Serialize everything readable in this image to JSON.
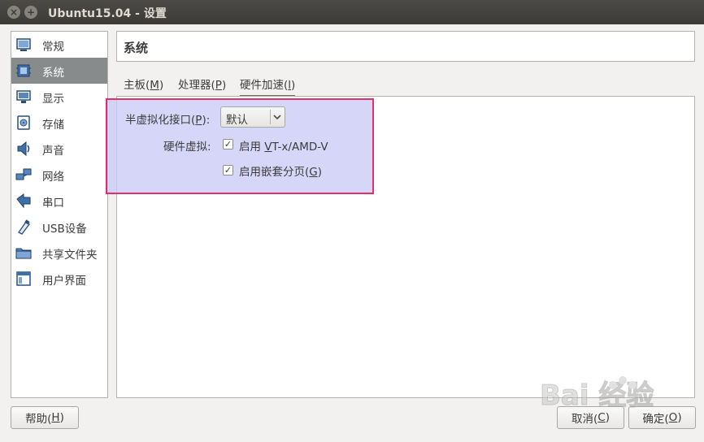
{
  "window": {
    "title": "Ubuntu15.04 - 设置",
    "close_glyph": "×",
    "max_glyph": "+"
  },
  "sidebar": {
    "items": [
      {
        "label": "常规",
        "icon": "general-icon"
      },
      {
        "label": "系统",
        "icon": "system-icon",
        "selected": true
      },
      {
        "label": "显示",
        "icon": "display-icon"
      },
      {
        "label": "存储",
        "icon": "storage-icon"
      },
      {
        "label": "声音",
        "icon": "audio-icon"
      },
      {
        "label": "网络",
        "icon": "network-icon"
      },
      {
        "label": "串口",
        "icon": "serial-port-icon"
      },
      {
        "label": "USB设备",
        "icon": "usb-icon"
      },
      {
        "label": "共享文件夹",
        "icon": "shared-folder-icon"
      },
      {
        "label": "用户界面",
        "icon": "user-interface-icon"
      }
    ]
  },
  "page": {
    "title": "系统"
  },
  "tabs": [
    {
      "label": "主板(",
      "key": "M",
      "suffix": ")"
    },
    {
      "label": "处理器(",
      "key": "P",
      "suffix": ")"
    },
    {
      "label": "硬件加速(",
      "key": "l",
      "suffix": ")",
      "active": true
    }
  ],
  "acceleration": {
    "paravirt_label": "半虚拟化接口(",
    "paravirt_key": "P",
    "paravirt_suffix": "):",
    "paravirt_value": "默认",
    "hw_virt_label": "硬件虚拟:",
    "vtx_checked": true,
    "vtx_label_prefix": "启用 ",
    "vtx_label_key": "V",
    "vtx_label_rest": "T-x/AMD-V",
    "nested_checked": true,
    "nested_label": "启用嵌套分页(",
    "nested_key": "G",
    "nested_suffix": ")",
    "check_glyph": "✓"
  },
  "buttons": {
    "help": "帮助(",
    "help_key": "H",
    "help_suffix": ")",
    "cancel": "取消(",
    "cancel_key": "C",
    "cancel_suffix": ")",
    "ok": "确定(",
    "ok_key": "O",
    "ok_suffix": ")"
  },
  "watermark": {
    "text": "Bai 经验"
  },
  "colors": {
    "highlight_border": "#e0306a",
    "highlight_fill": "#c8c8f5",
    "selected_item": "#878b8c",
    "titlebar": "#3c3b37"
  }
}
